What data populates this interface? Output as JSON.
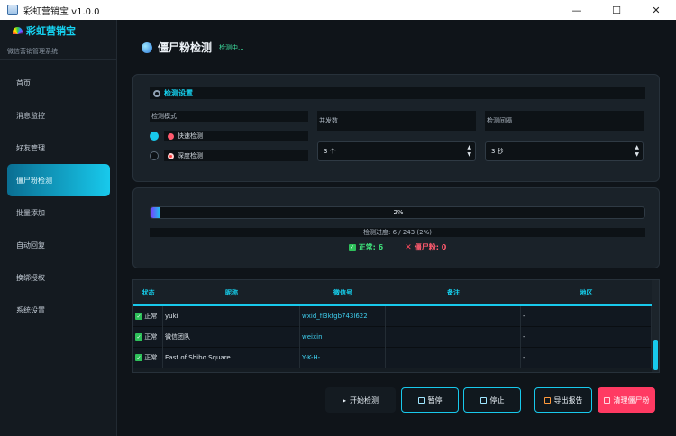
{
  "window": {
    "title": "彩虹营销宝 v1.0.0",
    "min": "—",
    "max": "☐",
    "close": "✕"
  },
  "sidebar": {
    "brand": "彩虹营销宝",
    "subtitle": "微信营销管理系统",
    "items": [
      {
        "label": "首页"
      },
      {
        "label": "消息监控"
      },
      {
        "label": "好友管理"
      },
      {
        "label": "僵尸粉检测"
      },
      {
        "label": "批量添加"
      },
      {
        "label": "自动回复"
      },
      {
        "label": "换绑授权"
      },
      {
        "label": "系统设置"
      }
    ]
  },
  "page": {
    "title": "僵尸粉检测",
    "status": "检测中..."
  },
  "settings": {
    "heading": "检测设置",
    "mode_label": "检测模式",
    "modes": [
      {
        "label": "快速检测",
        "selected": true
      },
      {
        "label": "深度检测",
        "selected": false
      }
    ],
    "concurrency_label": "并发数",
    "concurrency_value": "3 个",
    "interval_label": "检测间隔",
    "interval_value": "3 秒"
  },
  "progress": {
    "percent_text": "2%",
    "fraction": 0.02,
    "detail": "检测进度: 6 / 243 (2%)",
    "normal": "正常: 6",
    "zombie": "僵尸粉: 0"
  },
  "table": {
    "headers": [
      "状态",
      "昵称",
      "微信号",
      "备注",
      "地区"
    ],
    "rows": [
      {
        "status": "正常",
        "nickname": "yuki",
        "wxid": "wxid_fl3kfgb743l622",
        "remark": "",
        "region": "-"
      },
      {
        "status": "正常",
        "nickname": "微信团队",
        "wxid": "weixin",
        "remark": "",
        "region": "-"
      },
      {
        "status": "正常",
        "nickname": "East of Shibo Square",
        "wxid": "Y-K-H-",
        "remark": "",
        "region": "-"
      }
    ]
  },
  "actions": {
    "start": "开始检测",
    "pause": "暂停",
    "stop": "停止",
    "export": "导出报告",
    "clean": "清理僵尸粉"
  },
  "colors": {
    "accent": "#18c9ec",
    "danger": "#ff3a62",
    "ok": "#3ee07a"
  }
}
